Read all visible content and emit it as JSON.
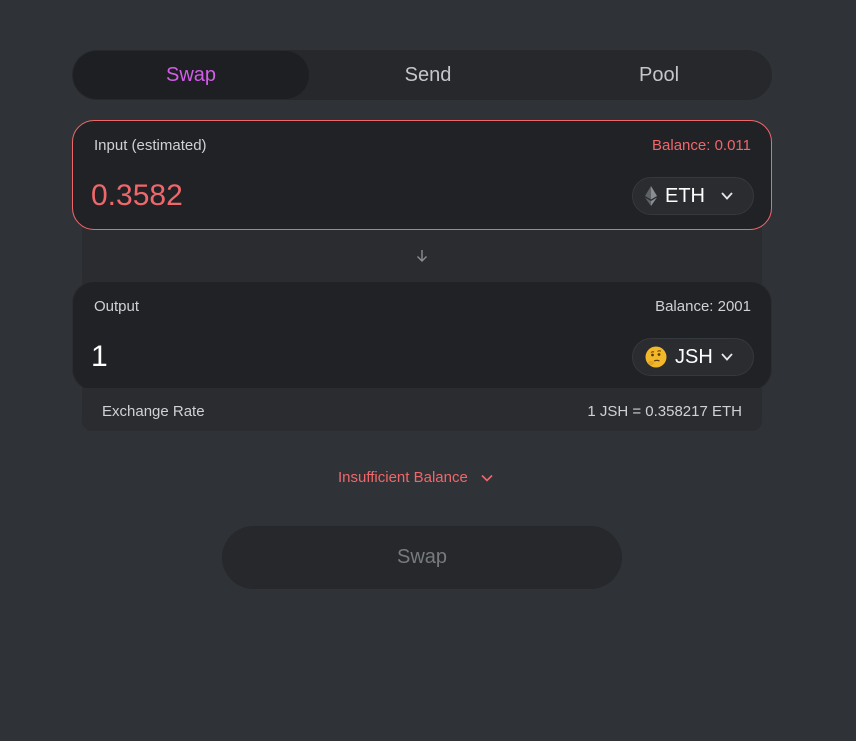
{
  "tabs": [
    {
      "label": "Swap",
      "active": true
    },
    {
      "label": "Send",
      "active": false
    },
    {
      "label": "Pool",
      "active": false
    }
  ],
  "input": {
    "label": "Input (estimated)",
    "balance": "Balance: 0.011",
    "amount": "0.3582",
    "token": "ETH",
    "token_icon": "ethereum-icon"
  },
  "output": {
    "label": "Output",
    "balance": "Balance: 2001",
    "amount": "1",
    "token": "JSH",
    "token_icon": "thinking-face-icon"
  },
  "exchange": {
    "label": "Exchange Rate",
    "value": "1 JSH = 0.358217 ETH"
  },
  "warning": "Insufficient Balance",
  "swap_button": "Swap",
  "colors": {
    "accent": "#d25de8",
    "error": "#f0676b",
    "background": "#2f3236"
  }
}
